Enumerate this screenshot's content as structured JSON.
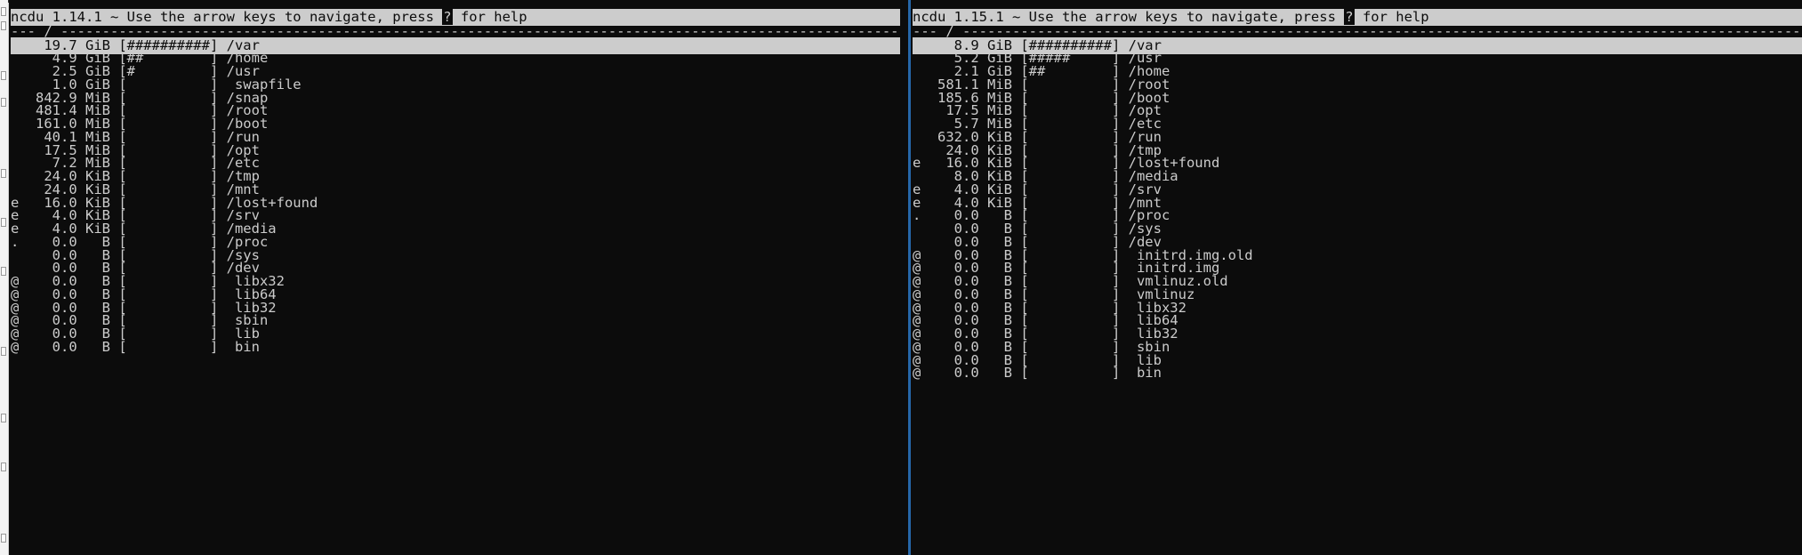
{
  "panes": {
    "left": {
      "title_before_key": "ncdu 1.14.1 ~ Use the arrow keys to navigate, press ",
      "help_key": "?",
      "title_after_key": " for help",
      "path_line": "--- / ----------------------------------------------------------------------------------------------------------",
      "entries": [
        {
          "flag": " ",
          "size": "19.7",
          "unit": "GiB",
          "bar": "##########",
          "name": "/var"
        },
        {
          "flag": " ",
          "size": "4.9",
          "unit": "GiB",
          "bar": "##",
          "name": "/home"
        },
        {
          "flag": " ",
          "size": "2.5",
          "unit": "GiB",
          "bar": "#",
          "name": "/usr"
        },
        {
          "flag": " ",
          "size": "1.0",
          "unit": "GiB",
          "bar": "",
          "name": " swapfile"
        },
        {
          "flag": " ",
          "size": "842.9",
          "unit": "MiB",
          "bar": "",
          "name": "/snap"
        },
        {
          "flag": " ",
          "size": "481.4",
          "unit": "MiB",
          "bar": "",
          "name": "/root"
        },
        {
          "flag": " ",
          "size": "161.0",
          "unit": "MiB",
          "bar": "",
          "name": "/boot"
        },
        {
          "flag": " ",
          "size": "40.1",
          "unit": "MiB",
          "bar": "",
          "name": "/run"
        },
        {
          "flag": " ",
          "size": "17.5",
          "unit": "MiB",
          "bar": "",
          "name": "/opt"
        },
        {
          "flag": " ",
          "size": "7.2",
          "unit": "MiB",
          "bar": "",
          "name": "/etc"
        },
        {
          "flag": " ",
          "size": "24.0",
          "unit": "KiB",
          "bar": "",
          "name": "/tmp"
        },
        {
          "flag": " ",
          "size": "24.0",
          "unit": "KiB",
          "bar": "",
          "name": "/mnt"
        },
        {
          "flag": "e",
          "size": "16.0",
          "unit": "KiB",
          "bar": "",
          "name": "/lost+found"
        },
        {
          "flag": "e",
          "size": "4.0",
          "unit": "KiB",
          "bar": "",
          "name": "/srv"
        },
        {
          "flag": "e",
          "size": "4.0",
          "unit": "KiB",
          "bar": "",
          "name": "/media"
        },
        {
          "flag": ".",
          "size": "0.0",
          "unit": "B",
          "bar": "",
          "name": "/proc"
        },
        {
          "flag": " ",
          "size": "0.0",
          "unit": "B",
          "bar": "",
          "name": "/sys"
        },
        {
          "flag": " ",
          "size": "0.0",
          "unit": "B",
          "bar": "",
          "name": "/dev"
        },
        {
          "flag": "@",
          "size": "0.0",
          "unit": "B",
          "bar": "",
          "name": " libx32"
        },
        {
          "flag": "@",
          "size": "0.0",
          "unit": "B",
          "bar": "",
          "name": " lib64"
        },
        {
          "flag": "@",
          "size": "0.0",
          "unit": "B",
          "bar": "",
          "name": " lib32"
        },
        {
          "flag": "@",
          "size": "0.0",
          "unit": "B",
          "bar": "",
          "name": " sbin"
        },
        {
          "flag": "@",
          "size": "0.0",
          "unit": "B",
          "bar": "",
          "name": " lib"
        },
        {
          "flag": "@",
          "size": "0.0",
          "unit": "B",
          "bar": "",
          "name": " bin"
        }
      ]
    },
    "right": {
      "title_before_key": "ncdu 1.15.1 ~ Use the arrow keys to navigate, press ",
      "help_key": "?",
      "title_after_key": " for help",
      "path_line": "--- / ----------------------------------------------------------------------------------------------------------",
      "entries": [
        {
          "flag": " ",
          "size": "8.9",
          "unit": "GiB",
          "bar": "##########",
          "name": "/var"
        },
        {
          "flag": " ",
          "size": "5.2",
          "unit": "GiB",
          "bar": "#####",
          "name": "/usr"
        },
        {
          "flag": " ",
          "size": "2.1",
          "unit": "GiB",
          "bar": "##",
          "name": "/home"
        },
        {
          "flag": " ",
          "size": "581.1",
          "unit": "MiB",
          "bar": "",
          "name": "/root"
        },
        {
          "flag": " ",
          "size": "185.6",
          "unit": "MiB",
          "bar": "",
          "name": "/boot"
        },
        {
          "flag": " ",
          "size": "17.5",
          "unit": "MiB",
          "bar": "",
          "name": "/opt"
        },
        {
          "flag": " ",
          "size": "5.7",
          "unit": "MiB",
          "bar": "",
          "name": "/etc"
        },
        {
          "flag": " ",
          "size": "632.0",
          "unit": "KiB",
          "bar": "",
          "name": "/run"
        },
        {
          "flag": " ",
          "size": "24.0",
          "unit": "KiB",
          "bar": "",
          "name": "/tmp"
        },
        {
          "flag": "e",
          "size": "16.0",
          "unit": "KiB",
          "bar": "",
          "name": "/lost+found"
        },
        {
          "flag": " ",
          "size": "8.0",
          "unit": "KiB",
          "bar": "",
          "name": "/media"
        },
        {
          "flag": "e",
          "size": "4.0",
          "unit": "KiB",
          "bar": "",
          "name": "/srv"
        },
        {
          "flag": "e",
          "size": "4.0",
          "unit": "KiB",
          "bar": "",
          "name": "/mnt"
        },
        {
          "flag": ".",
          "size": "0.0",
          "unit": "B",
          "bar": "",
          "name": "/proc"
        },
        {
          "flag": " ",
          "size": "0.0",
          "unit": "B",
          "bar": "",
          "name": "/sys"
        },
        {
          "flag": " ",
          "size": "0.0",
          "unit": "B",
          "bar": "",
          "name": "/dev"
        },
        {
          "flag": "@",
          "size": "0.0",
          "unit": "B",
          "bar": "",
          "name": " initrd.img.old"
        },
        {
          "flag": "@",
          "size": "0.0",
          "unit": "B",
          "bar": "",
          "name": " initrd.img"
        },
        {
          "flag": "@",
          "size": "0.0",
          "unit": "B",
          "bar": "",
          "name": " vmlinuz.old"
        },
        {
          "flag": "@",
          "size": "0.0",
          "unit": "B",
          "bar": "",
          "name": " vmlinuz"
        },
        {
          "flag": "@",
          "size": "0.0",
          "unit": "B",
          "bar": "",
          "name": " libx32"
        },
        {
          "flag": "@",
          "size": "0.0",
          "unit": "B",
          "bar": "",
          "name": " lib64"
        },
        {
          "flag": "@",
          "size": "0.0",
          "unit": "B",
          "bar": "",
          "name": " lib32"
        },
        {
          "flag": "@",
          "size": "0.0",
          "unit": "B",
          "bar": "",
          "name": " sbin"
        },
        {
          "flag": "@",
          "size": "0.0",
          "unit": "B",
          "bar": "",
          "name": " lib"
        },
        {
          "flag": "@",
          "size": "0.0",
          "unit": "B",
          "bar": "",
          "name": " bin"
        }
      ]
    }
  },
  "colors": {
    "background": "#0c0c0c",
    "foreground": "#cccccc",
    "inverse_bg": "#cccccc",
    "divider": "#2667a9"
  }
}
